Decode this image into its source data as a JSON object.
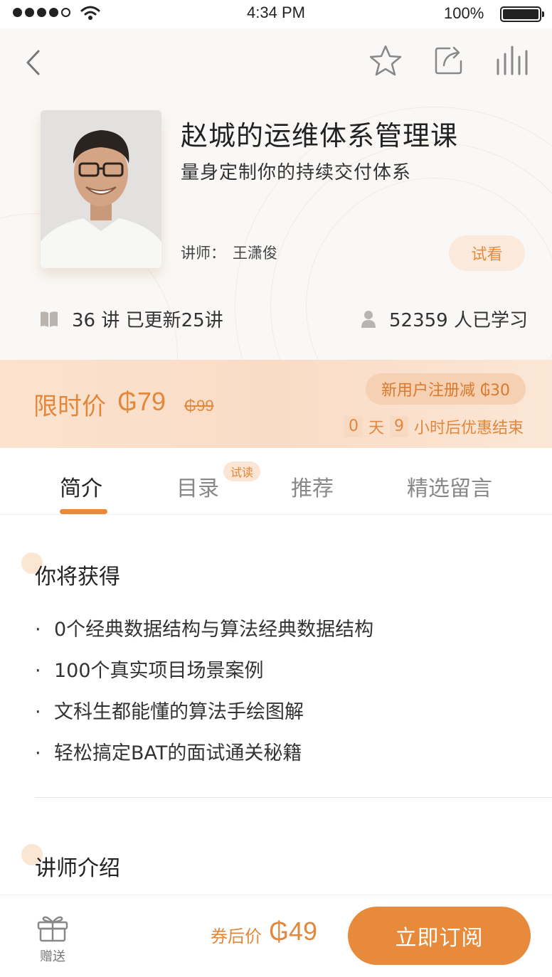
{
  "status_bar": {
    "time": "4:34 PM",
    "battery": "100%"
  },
  "header": {
    "back_icon": "chevron-left-icon",
    "actions": [
      "star-icon",
      "share-icon",
      "bar-chart-icon"
    ]
  },
  "course": {
    "title": "赵城的运维体系管理课",
    "subtitle": "量身定制你的持续交付体系",
    "lecturer_label": "讲师：",
    "lecturer_name": "王潇俊",
    "trial_label": "试看",
    "lessons_text": "36 讲 已更新25讲",
    "learners_text": "52359 人已学习"
  },
  "price": {
    "label": "限时价",
    "current": "₲79",
    "original": "₲99",
    "promo": "新用户注册减 ₲30",
    "countdown_days": "0",
    "countdown_days_unit": "天",
    "countdown_hours": "9",
    "countdown_suffix": "小时后优惠结束"
  },
  "tabs": {
    "intro": "简介",
    "catalog": "目录",
    "catalog_badge": "试读",
    "recommend": "推荐",
    "comments": "精选留言",
    "active": "intro"
  },
  "content": {
    "gain_title": "你将获得",
    "gains": [
      "0个经典数据结构与算法经典数据结构",
      "100个真实项目场景案例",
      "文科生都能懂的算法手绘图解",
      "轻松搞定BAT的面试通关秘籍"
    ],
    "bullet": "·",
    "lecturer_intro_title": "讲师介绍"
  },
  "bottom_bar": {
    "gift_label": "赠送",
    "after_coupon_label": "券后价",
    "after_coupon_price": "₲49",
    "subscribe_label": "立即订阅"
  },
  "colors": {
    "accent": "#e78a3c",
    "price_band": "#f9dcc6",
    "badge_bg": "#fbe5d5"
  }
}
